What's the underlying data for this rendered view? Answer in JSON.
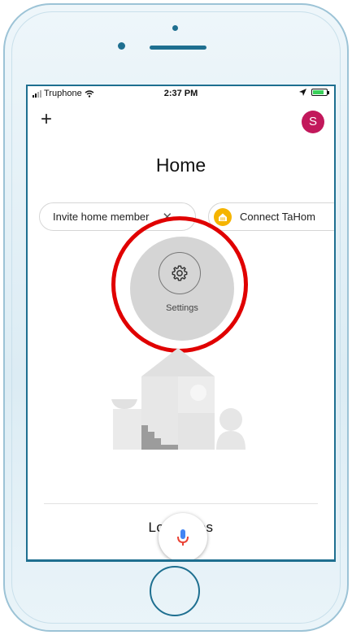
{
  "status_bar": {
    "carrier": "Truphone",
    "time": "2:37 PM"
  },
  "header": {
    "add_label": "+",
    "avatar_initial": "S",
    "avatar_color": "#c2185b"
  },
  "page_title": "Home",
  "chips": {
    "invite": {
      "label": "Invite home member",
      "dismiss": "✕"
    },
    "connect": {
      "label": "Connect TaHom",
      "icon": "home-badge-icon",
      "color": "#f5b400"
    }
  },
  "settings": {
    "label": "Settings",
    "icon": "gear-icon"
  },
  "annotation": {
    "ring_color": "#e00000"
  },
  "local_devices": {
    "label": "Loca'      ices"
  },
  "assistant": {
    "icon": "mic-icon"
  }
}
